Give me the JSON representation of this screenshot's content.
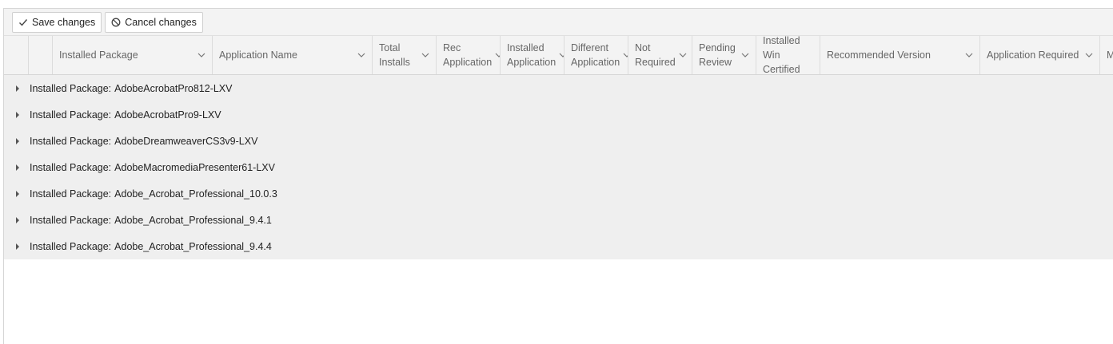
{
  "toolbar": {
    "save_label": "Save changes",
    "cancel_label": "Cancel changes",
    "save_icon": "check-icon",
    "cancel_icon": "prohibit-icon"
  },
  "grid": {
    "columns": [
      {
        "id": "expand",
        "label": ""
      },
      {
        "id": "select",
        "label": ""
      },
      {
        "id": "installed_package",
        "label": "Installed Package"
      },
      {
        "id": "application_name",
        "label": "Application Name"
      },
      {
        "id": "total_installs",
        "label": "Total Installs"
      },
      {
        "id": "rec_application",
        "label": "Rec Application"
      },
      {
        "id": "installed_application",
        "label": "Installed Application"
      },
      {
        "id": "different_application",
        "label": "Different Application"
      },
      {
        "id": "not_required",
        "label": "Not Required"
      },
      {
        "id": "pending_review",
        "label": "Pending Review"
      },
      {
        "id": "installed_win_certified",
        "label": "Installed Win Certified"
      },
      {
        "id": "recommended_version",
        "label": "Recommended Version"
      },
      {
        "id": "application_required",
        "label": "Application Required"
      },
      {
        "id": "more",
        "label": "M"
      }
    ],
    "group_prefix": "Installed Package:",
    "groups": [
      {
        "value": "AdobeAcrobatPro812-LXV"
      },
      {
        "value": "AdobeAcrobatPro9-LXV"
      },
      {
        "value": "AdobeDreamweaverCS3v9-LXV"
      },
      {
        "value": "AdobeMacromediaPresenter61-LXV"
      },
      {
        "value": "Adobe_Acrobat_Professional_10.0.3"
      },
      {
        "value": "Adobe_Acrobat_Professional_9.4.1"
      },
      {
        "value": "Adobe_Acrobat_Professional_9.4.4"
      }
    ]
  },
  "colors": {
    "toolbar_bg": "#f3f3f3",
    "header_bg": "#f3f3f3",
    "rows_bg": "#efefef",
    "border": "#d6d6d6"
  }
}
